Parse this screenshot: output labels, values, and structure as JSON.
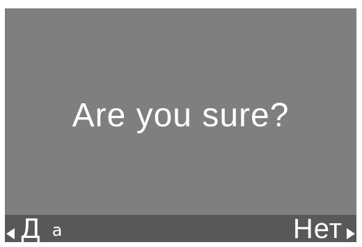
{
  "dialog": {
    "message": "Are you sure?"
  },
  "softkeys": {
    "left": {
      "label_main": "Д",
      "label_suffix": "а",
      "icon": "triangle-left-icon"
    },
    "right": {
      "label": "Нет",
      "icon": "triangle-right-icon"
    }
  },
  "colors": {
    "screen_background": "#7f7f7f",
    "softkey_bar_background": "#585858",
    "text": "#ffffff"
  }
}
